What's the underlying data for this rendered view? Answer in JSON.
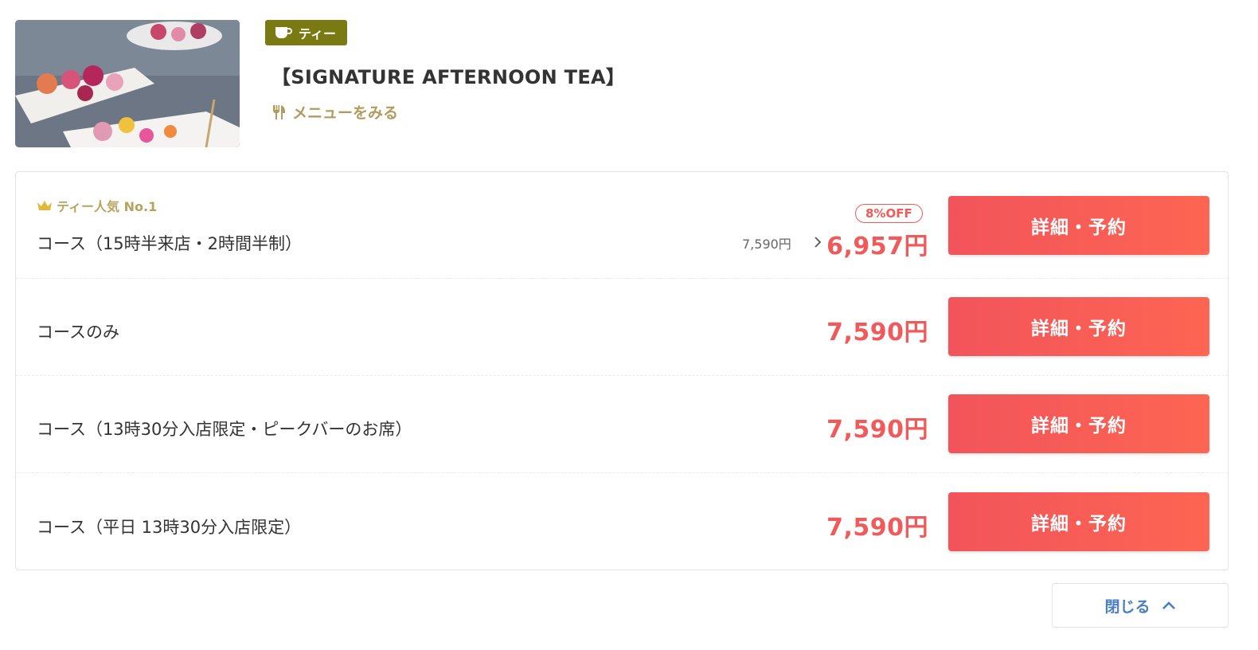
{
  "header": {
    "category_tag": "ティー",
    "course_title": "【SIGNATURE AFTERNOON TEA】",
    "menu_link": "メニューをみる"
  },
  "plans": [
    {
      "badge": "ティー人気 No.1",
      "name": "コース（15時半来店・2時間半制）",
      "original_price": "7,590円",
      "discount": "8%OFF",
      "price": "6,957円",
      "button": "詳細・予約"
    },
    {
      "name": "コースのみ",
      "price": "7,590円",
      "button": "詳細・予約"
    },
    {
      "name": "コース（13時30分入店限定・ピークバーのお席）",
      "price": "7,590円",
      "button": "詳細・予約"
    },
    {
      "name": "コース（平日 13時30分入店限定）",
      "price": "7,590円",
      "button": "詳細・予約"
    }
  ],
  "close_button": "閉じる",
  "colors": {
    "accent_red": "#f05a5a",
    "tag_olive": "#7a7a12",
    "gold": "#b29b5e",
    "link_blue": "#4a7fc1"
  },
  "icons": {
    "tag": "teacup-icon",
    "menu": "cutlery-icon",
    "popular": "crown-icon",
    "price_arrow": "chevron-right-icon",
    "close": "chevron-up-icon"
  }
}
